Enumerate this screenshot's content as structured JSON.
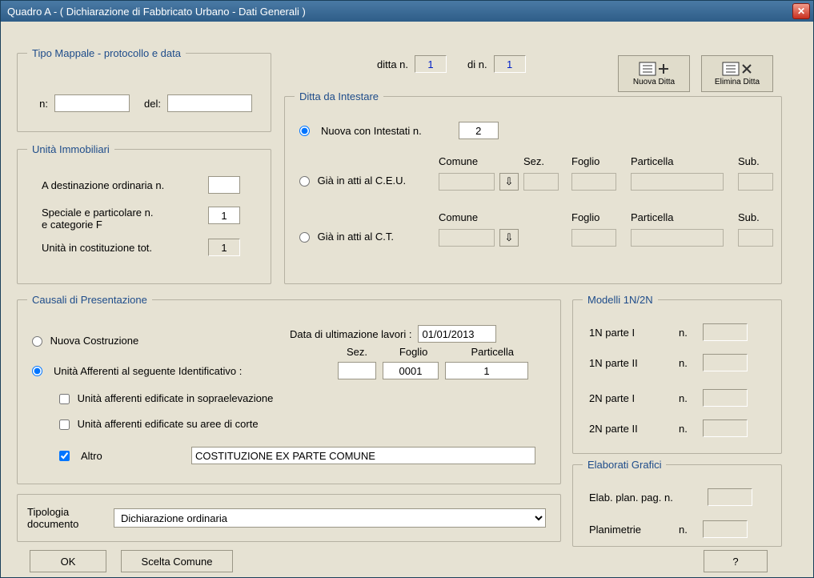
{
  "window": {
    "title": "Quadro A - ( Dichiarazione di Fabbricato Urbano - Dati Generali )"
  },
  "top": {
    "ditta_n_label": "ditta n.",
    "ditta_n_value": "1",
    "di_n_label": "di  n.",
    "di_n_value": "1",
    "nuova_ditta": "Nuova  Ditta",
    "elimina_ditta": "Elimina  Ditta"
  },
  "tipo_mappale": {
    "legend": "Tipo Mappale - protocollo e data",
    "n_label": "n:",
    "n_value": "",
    "del_label": "del:",
    "del_value": ""
  },
  "unita_immobiliari": {
    "legend": "Unità Immobiliari",
    "a_dest_ord": "A destinazione ordinaria  n.",
    "a_dest_ord_value": "",
    "speciale": "Speciale e particolare     n.",
    "speciale2": "e categorie F",
    "speciale_value": "1",
    "in_costituzione": "Unità in costituzione      tot.",
    "in_cost_value": "1"
  },
  "ditta_intestare": {
    "legend": "Ditta da Intestare",
    "nuova_label": "Nuova con Intestati n.",
    "nuova_value": "2",
    "gia_ceu": "Già in atti al C.E.U.",
    "gia_ct": "Già in atti al C.T.",
    "hdr_comune": "Comune",
    "hdr_sez": "Sez.",
    "hdr_foglio": "Foglio",
    "hdr_part": "Particella",
    "hdr_sub": "Sub."
  },
  "causali": {
    "legend": "Causali di Presentazione",
    "nuova_costruzione": "Nuova Costruzione",
    "data_ultim_label": "Data di ultimazione lavori :",
    "data_ultim_value": "01/01/2013",
    "unita_afferenti": "Unità Afferenti al seguente Identificativo :",
    "sez_label": "Sez.",
    "foglio_label": "Foglio",
    "particella_label": "Particella",
    "sez_value": "",
    "foglio_value": "0001",
    "particella_value": "1",
    "chk_sopra": "Unità afferenti edificate in sopraelevazione",
    "chk_aree": "Unità afferenti edificate su aree di corte",
    "chk_altro": "Altro",
    "altro_value": "COSTITUZIONE EX PARTE COMUNE"
  },
  "modelli": {
    "legend": "Modelli 1N/2N",
    "r1": "1N parte I",
    "r2": "1N parte II",
    "r3": "2N parte I",
    "r4": "2N parte II",
    "n_label": "n."
  },
  "elaborati": {
    "legend": "Elaborati Grafici",
    "r1": "Elab. plan. pag. n.",
    "r2": "Planimetrie",
    "n_label": "n."
  },
  "bottom": {
    "tipologia_label": "Tipologia",
    "documento_label": "documento",
    "tipologia_value": "Dichiarazione ordinaria",
    "ok": "OK",
    "scelta_comune": "Scelta Comune",
    "help": "?"
  }
}
